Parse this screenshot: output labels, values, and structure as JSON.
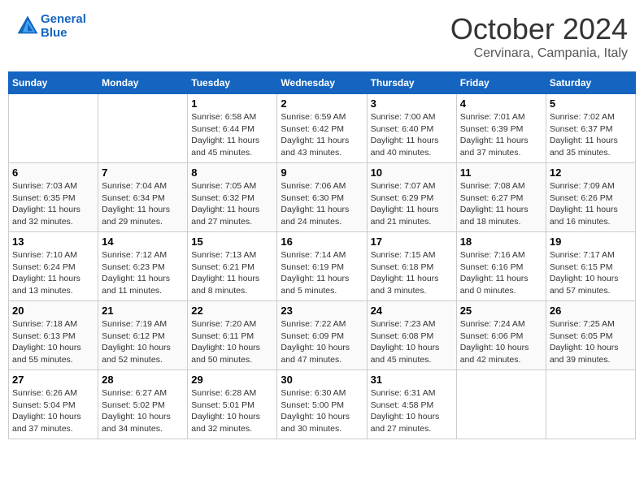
{
  "header": {
    "logo_line1": "General",
    "logo_line2": "Blue",
    "month": "October 2024",
    "location": "Cervinara, Campania, Italy"
  },
  "weekdays": [
    "Sunday",
    "Monday",
    "Tuesday",
    "Wednesday",
    "Thursday",
    "Friday",
    "Saturday"
  ],
  "weeks": [
    [
      null,
      null,
      {
        "day": "1",
        "sunrise": "Sunrise: 6:58 AM",
        "sunset": "Sunset: 6:44 PM",
        "daylight": "Daylight: 11 hours and 45 minutes."
      },
      {
        "day": "2",
        "sunrise": "Sunrise: 6:59 AM",
        "sunset": "Sunset: 6:42 PM",
        "daylight": "Daylight: 11 hours and 43 minutes."
      },
      {
        "day": "3",
        "sunrise": "Sunrise: 7:00 AM",
        "sunset": "Sunset: 6:40 PM",
        "daylight": "Daylight: 11 hours and 40 minutes."
      },
      {
        "day": "4",
        "sunrise": "Sunrise: 7:01 AM",
        "sunset": "Sunset: 6:39 PM",
        "daylight": "Daylight: 11 hours and 37 minutes."
      },
      {
        "day": "5",
        "sunrise": "Sunrise: 7:02 AM",
        "sunset": "Sunset: 6:37 PM",
        "daylight": "Daylight: 11 hours and 35 minutes."
      }
    ],
    [
      {
        "day": "6",
        "sunrise": "Sunrise: 7:03 AM",
        "sunset": "Sunset: 6:35 PM",
        "daylight": "Daylight: 11 hours and 32 minutes."
      },
      {
        "day": "7",
        "sunrise": "Sunrise: 7:04 AM",
        "sunset": "Sunset: 6:34 PM",
        "daylight": "Daylight: 11 hours and 29 minutes."
      },
      {
        "day": "8",
        "sunrise": "Sunrise: 7:05 AM",
        "sunset": "Sunset: 6:32 PM",
        "daylight": "Daylight: 11 hours and 27 minutes."
      },
      {
        "day": "9",
        "sunrise": "Sunrise: 7:06 AM",
        "sunset": "Sunset: 6:30 PM",
        "daylight": "Daylight: 11 hours and 24 minutes."
      },
      {
        "day": "10",
        "sunrise": "Sunrise: 7:07 AM",
        "sunset": "Sunset: 6:29 PM",
        "daylight": "Daylight: 11 hours and 21 minutes."
      },
      {
        "day": "11",
        "sunrise": "Sunrise: 7:08 AM",
        "sunset": "Sunset: 6:27 PM",
        "daylight": "Daylight: 11 hours and 18 minutes."
      },
      {
        "day": "12",
        "sunrise": "Sunrise: 7:09 AM",
        "sunset": "Sunset: 6:26 PM",
        "daylight": "Daylight: 11 hours and 16 minutes."
      }
    ],
    [
      {
        "day": "13",
        "sunrise": "Sunrise: 7:10 AM",
        "sunset": "Sunset: 6:24 PM",
        "daylight": "Daylight: 11 hours and 13 minutes."
      },
      {
        "day": "14",
        "sunrise": "Sunrise: 7:12 AM",
        "sunset": "Sunset: 6:23 PM",
        "daylight": "Daylight: 11 hours and 11 minutes."
      },
      {
        "day": "15",
        "sunrise": "Sunrise: 7:13 AM",
        "sunset": "Sunset: 6:21 PM",
        "daylight": "Daylight: 11 hours and 8 minutes."
      },
      {
        "day": "16",
        "sunrise": "Sunrise: 7:14 AM",
        "sunset": "Sunset: 6:19 PM",
        "daylight": "Daylight: 11 hours and 5 minutes."
      },
      {
        "day": "17",
        "sunrise": "Sunrise: 7:15 AM",
        "sunset": "Sunset: 6:18 PM",
        "daylight": "Daylight: 11 hours and 3 minutes."
      },
      {
        "day": "18",
        "sunrise": "Sunrise: 7:16 AM",
        "sunset": "Sunset: 6:16 PM",
        "daylight": "Daylight: 11 hours and 0 minutes."
      },
      {
        "day": "19",
        "sunrise": "Sunrise: 7:17 AM",
        "sunset": "Sunset: 6:15 PM",
        "daylight": "Daylight: 10 hours and 57 minutes."
      }
    ],
    [
      {
        "day": "20",
        "sunrise": "Sunrise: 7:18 AM",
        "sunset": "Sunset: 6:13 PM",
        "daylight": "Daylight: 10 hours and 55 minutes."
      },
      {
        "day": "21",
        "sunrise": "Sunrise: 7:19 AM",
        "sunset": "Sunset: 6:12 PM",
        "daylight": "Daylight: 10 hours and 52 minutes."
      },
      {
        "day": "22",
        "sunrise": "Sunrise: 7:20 AM",
        "sunset": "Sunset: 6:11 PM",
        "daylight": "Daylight: 10 hours and 50 minutes."
      },
      {
        "day": "23",
        "sunrise": "Sunrise: 7:22 AM",
        "sunset": "Sunset: 6:09 PM",
        "daylight": "Daylight: 10 hours and 47 minutes."
      },
      {
        "day": "24",
        "sunrise": "Sunrise: 7:23 AM",
        "sunset": "Sunset: 6:08 PM",
        "daylight": "Daylight: 10 hours and 45 minutes."
      },
      {
        "day": "25",
        "sunrise": "Sunrise: 7:24 AM",
        "sunset": "Sunset: 6:06 PM",
        "daylight": "Daylight: 10 hours and 42 minutes."
      },
      {
        "day": "26",
        "sunrise": "Sunrise: 7:25 AM",
        "sunset": "Sunset: 6:05 PM",
        "daylight": "Daylight: 10 hours and 39 minutes."
      }
    ],
    [
      {
        "day": "27",
        "sunrise": "Sunrise: 6:26 AM",
        "sunset": "Sunset: 5:04 PM",
        "daylight": "Daylight: 10 hours and 37 minutes."
      },
      {
        "day": "28",
        "sunrise": "Sunrise: 6:27 AM",
        "sunset": "Sunset: 5:02 PM",
        "daylight": "Daylight: 10 hours and 34 minutes."
      },
      {
        "day": "29",
        "sunrise": "Sunrise: 6:28 AM",
        "sunset": "Sunset: 5:01 PM",
        "daylight": "Daylight: 10 hours and 32 minutes."
      },
      {
        "day": "30",
        "sunrise": "Sunrise: 6:30 AM",
        "sunset": "Sunset: 5:00 PM",
        "daylight": "Daylight: 10 hours and 30 minutes."
      },
      {
        "day": "31",
        "sunrise": "Sunrise: 6:31 AM",
        "sunset": "Sunset: 4:58 PM",
        "daylight": "Daylight: 10 hours and 27 minutes."
      },
      null,
      null
    ]
  ]
}
